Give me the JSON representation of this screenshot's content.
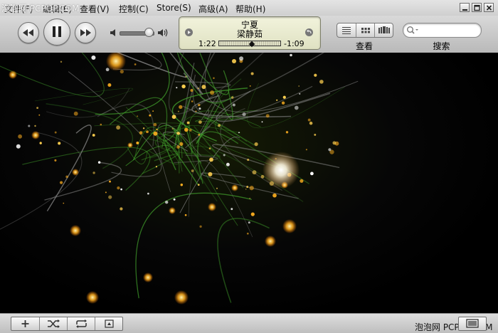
{
  "menu": {
    "items": [
      "文件(F)",
      "编辑(E)",
      "查看(V)",
      "控制(C)",
      "Store(S)",
      "高级(A)",
      "帮助(H)"
    ],
    "watermark": "泡泡网 PCPOP.COM"
  },
  "window_controls": {
    "icons": [
      "minimize-icon",
      "maximize-icon",
      "close-icon"
    ]
  },
  "transport": {
    "icons": [
      "previous-icon",
      "pause-icon",
      "next-icon"
    ]
  },
  "volume": {
    "level": 0.85,
    "icons": [
      "volume-low-icon",
      "volume-high-icon"
    ]
  },
  "now_playing": {
    "title": "宁夏",
    "artist": "梁静茹",
    "elapsed": "1:22",
    "remaining": "-1:09",
    "progress": 0.53
  },
  "view": {
    "label": "查看",
    "modes": [
      "list-view-icon",
      "grid-view-icon",
      "coverflow-view-icon"
    ]
  },
  "search": {
    "label": "搜索",
    "value": "",
    "placeholder": ""
  },
  "visualizer": {
    "accent": "#ffb020",
    "streak_color": "#3f9a2a"
  },
  "bottom": {
    "buttons": [
      "add-playlist-icon",
      "shuffle-icon",
      "repeat-icon",
      "artwork-toggle-icon"
    ],
    "watermark": "泡泡网  PCPOP.COM",
    "right_button": "display-icon"
  }
}
